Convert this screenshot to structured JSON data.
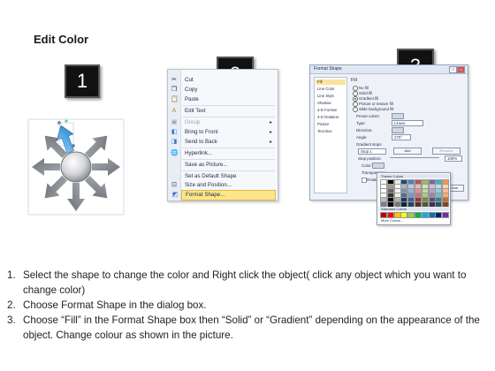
{
  "title": "Edit Color",
  "badges": [
    "1",
    "2",
    "3"
  ],
  "context_menu": {
    "items": [
      {
        "label": "Cut",
        "icon": "scissors-icon",
        "disabled": false,
        "submenu": false
      },
      {
        "label": "Copy",
        "icon": "copy-icon",
        "disabled": false,
        "submenu": false
      },
      {
        "label": "Paste",
        "icon": "paste-icon",
        "disabled": false,
        "submenu": false
      },
      {
        "label": "Edit Text",
        "icon": "text-icon",
        "disabled": false,
        "submenu": false
      },
      {
        "label": "Group",
        "icon": "group-icon",
        "disabled": true,
        "submenu": true
      },
      {
        "label": "Bring to Front",
        "icon": "bring-front-icon",
        "disabled": false,
        "submenu": true
      },
      {
        "label": "Send to Back",
        "icon": "send-back-icon",
        "disabled": false,
        "submenu": true
      },
      {
        "label": "Hyperlink...",
        "icon": "hyperlink-icon",
        "disabled": false,
        "submenu": false
      },
      {
        "label": "Save as Picture...",
        "icon": "",
        "disabled": false,
        "submenu": false
      },
      {
        "label": "Set as Default Shape",
        "icon": "",
        "disabled": false,
        "submenu": false
      },
      {
        "label": "Size and Position...",
        "icon": "size-icon",
        "disabled": false,
        "submenu": false
      },
      {
        "label": "Format Shape...",
        "icon": "format-icon",
        "disabled": false,
        "submenu": false,
        "highlighted": true
      }
    ]
  },
  "format_dialog": {
    "title": "Format Shape",
    "categories": [
      "Fill",
      "Line Color",
      "Line Style",
      "Shadow",
      "3-D Format",
      "3-D Rotation",
      "Picture",
      "Text Box"
    ],
    "section_title": "Fill",
    "fill_options": [
      "No fill",
      "Solid fill",
      "Gradient fill",
      "Picture or texture fill",
      "Slide background fill"
    ],
    "selected_fill": "Gradient fill",
    "preset_colors_label": "Preset colors:",
    "type_label": "Type:",
    "type_value": "Linear",
    "direction_label": "Direction:",
    "angle_label": "Angle:",
    "angle_value": "270°",
    "gradient_stops_label": "Gradient stops",
    "stop_value": "Stop 1",
    "add_label": "Add",
    "remove_label": "Remove",
    "stop_position_label": "Stop position:",
    "stop_position_value": "100%",
    "color_label": "Color:",
    "transparency_label": "Transparency:",
    "rotate_label": "Rotate with shape",
    "close_label": "Close"
  },
  "color_picker": {
    "theme_header": "Theme Colors",
    "standard_header": "Standard Colors",
    "more_colors": "More Colors...",
    "theme_top": [
      "#ffffff",
      "#000000",
      "#eeece1",
      "#1f497d",
      "#4f81bd",
      "#c0504d",
      "#9bbb59",
      "#8064a2",
      "#4bacc6",
      "#f79646"
    ],
    "standard": [
      "#c00000",
      "#ff0000",
      "#ffc000",
      "#ffff00",
      "#92d050",
      "#00b050",
      "#00b0f0",
      "#0070c0",
      "#002060",
      "#7030a0"
    ]
  },
  "instructions": [
    {
      "num": "1.",
      "text": "Select the shape to change the color and Right click the object( click any object which you want to change color)"
    },
    {
      "num": "2.",
      "text": "Choose Format Shape in the dialog box."
    },
    {
      "num": "3.",
      "text": "Choose “Fill” in the Format Shape box then “Solid” or “Gradient” depending on the appearance of the object. Change colour as shown in the picture."
    }
  ],
  "colors": {
    "highlight_arrow": "#3aa0e0",
    "arrow_gray": "#8a8f96",
    "menu_highlight": "#fde58a"
  }
}
